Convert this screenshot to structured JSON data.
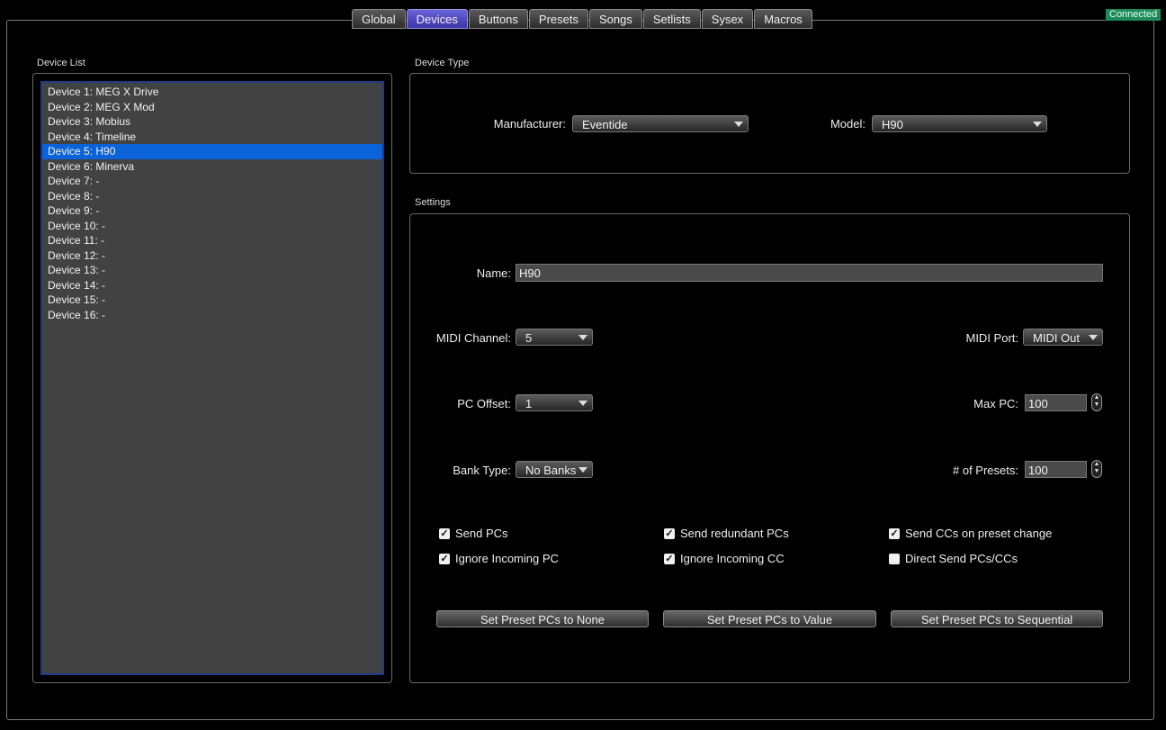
{
  "tabs": [
    {
      "label": "Global",
      "active": false
    },
    {
      "label": "Devices",
      "active": true
    },
    {
      "label": "Buttons",
      "active": false
    },
    {
      "label": "Presets",
      "active": false
    },
    {
      "label": "Songs",
      "active": false
    },
    {
      "label": "Setlists",
      "active": false
    },
    {
      "label": "Sysex",
      "active": false
    },
    {
      "label": "Macros",
      "active": false
    }
  ],
  "status": {
    "text": "Connected",
    "color": "#1f8a5a"
  },
  "device_list": {
    "label": "Device List",
    "selected_index": 4,
    "items": [
      "Device 1: MEG X Drive",
      "Device 2: MEG X Mod",
      "Device 3: Mobius",
      "Device 4: Timeline",
      "Device 5: H90",
      "Device 6: Minerva",
      "Device 7: -",
      "Device 8: -",
      "Device 9: -",
      "Device 10: -",
      "Device 11: -",
      "Device 12: -",
      "Device 13: -",
      "Device 14: -",
      "Device 15: -",
      "Device 16: -"
    ]
  },
  "device_type": {
    "label": "Device Type",
    "manufacturer_label": "Manufacturer:",
    "manufacturer_value": "Eventide",
    "model_label": "Model:",
    "model_value": "H90"
  },
  "settings": {
    "label": "Settings",
    "name_label": "Name:",
    "name_value": "H90",
    "midi_channel_label": "MIDI Channel:",
    "midi_channel_value": "5",
    "midi_port_label": "MIDI Port:",
    "midi_port_value": "MIDI Out",
    "pc_offset_label": "PC Offset:",
    "pc_offset_value": "1",
    "max_pc_label": "Max PC:",
    "max_pc_value": "100",
    "bank_type_label": "Bank Type:",
    "bank_type_value": "No Banks",
    "num_presets_label": "# of Presets:",
    "num_presets_value": "100",
    "checkboxes": [
      {
        "label": "Send PCs",
        "checked": true
      },
      {
        "label": "Send redundant PCs",
        "checked": true
      },
      {
        "label": "Send CCs on preset change",
        "checked": true
      },
      {
        "label": "Ignore Incoming PC",
        "checked": true
      },
      {
        "label": "Ignore Incoming CC",
        "checked": true
      },
      {
        "label": "Direct Send PCs/CCs",
        "checked": false
      }
    ],
    "buttons": {
      "none": "Set Preset PCs to None",
      "value": "Set Preset PCs to Value",
      "sequential": "Set Preset PCs to Sequential"
    }
  }
}
